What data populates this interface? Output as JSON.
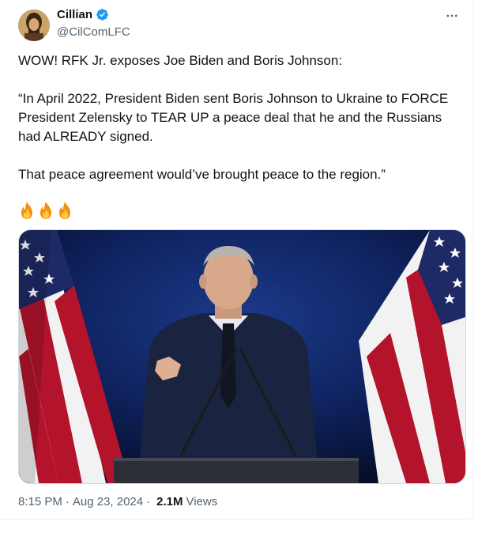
{
  "author": {
    "display_name": "Cillian",
    "handle": "@CilComLFC",
    "verified": true
  },
  "tweet": {
    "lines": [
      "WOW! RFK Jr. exposes Joe Biden and Boris Johnson:",
      "“In April 2022, President Biden sent Boris Johnson to Ukraine to FORCE",
      "President Zelensky to TEAR UP a peace deal that he and the Russians",
      "had ALREADY signed.",
      "That peace agreement would’ve brought peace to the region.”"
    ],
    "emojis": [
      "fire-icon",
      "fire-icon",
      "fire-icon"
    ]
  },
  "meta": {
    "time": "8:15 PM",
    "separator": "·",
    "date": "Aug 23, 2024",
    "views_count": "2.1M",
    "views_label": "Views"
  },
  "icons": {
    "more": "more-horizontal-icon",
    "verified": "verified-badge-icon"
  },
  "colors": {
    "text": "#0f1419",
    "secondary": "#536471",
    "verified": "#1d9bf0",
    "border": "#cfd9de"
  }
}
